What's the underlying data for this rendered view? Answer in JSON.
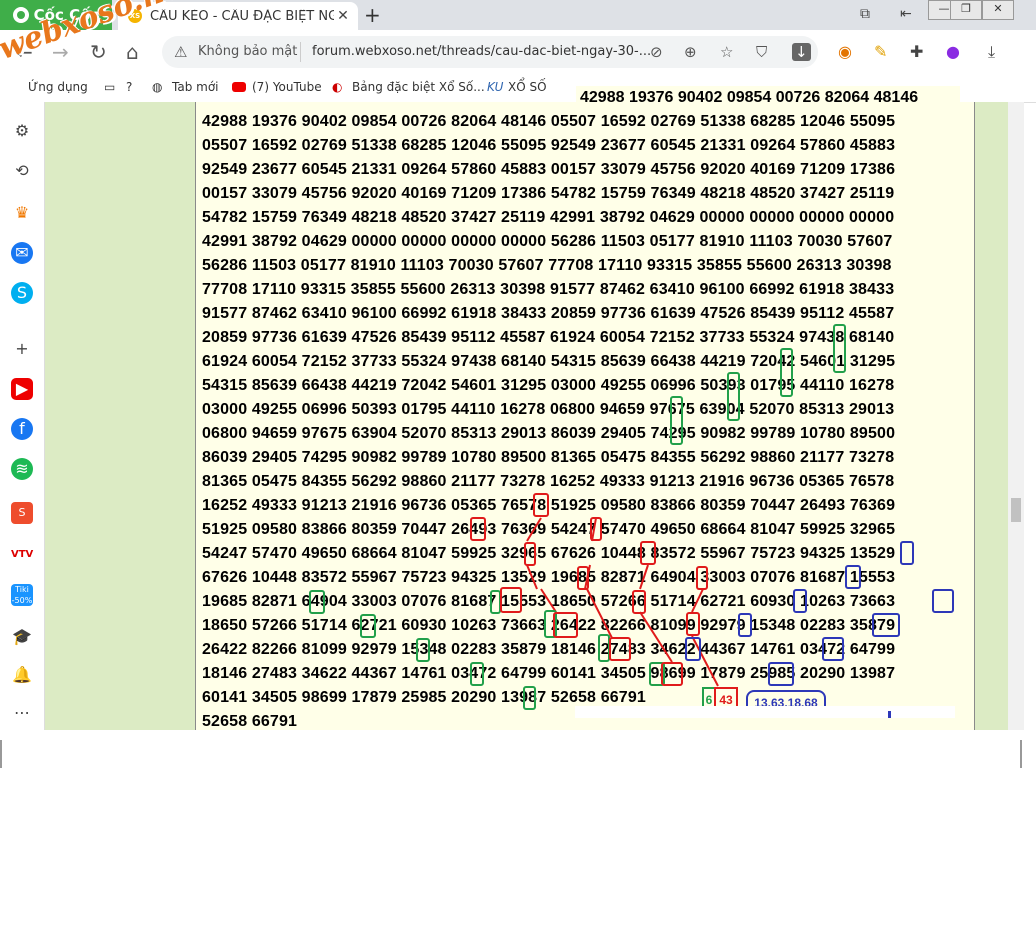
{
  "browser": {
    "brand": "Cốc Cốc",
    "tab_favicon": "XS",
    "tab_title": "CẦU KÈO - CẦU ĐẶC BIỆT NG",
    "security_label": "Không bảo mật",
    "url": "forum.webxoso.net/threads/cau-dac-biet-ngay-30-...",
    "bookmarks": [
      {
        "label": "Ứng dụng"
      },
      {
        "label": "?"
      },
      {
        "label": "Tab mới"
      },
      {
        "label": "(7) YouTube"
      },
      {
        "label": "Bảng đặc biệt Xổ Số..."
      },
      {
        "label": "XỔ SỐ"
      }
    ],
    "watermark": "webxoso.net"
  },
  "forum": {
    "top_line": "42988 19376 90402 09854 00726 82064 48146",
    "rows": [
      "42988 19376 90402 09854 00726 82064 48146 05507 16592 02769 51338 68285 12046 55095",
      "05507 16592 02769 51338 68285 12046 55095 92549 23677 60545 21331 09264 57860 45883",
      "92549 23677 60545 21331 09264 57860 45883 00157 33079 45756 92020 40169 71209 17386",
      "00157 33079 45756 92020 40169 71209 17386 54782 15759 76349 48218 48520 37427 25119",
      "54782 15759 76349 48218 48520 37427 25119 42991 38792 04629 00000 00000 00000 00000",
      "42991 38792 04629 00000 00000 00000 00000 56286 11503 05177 81910 11103 70030 57607",
      "56286 11503 05177 81910 11103 70030 57607 77708 17110 93315 35855 55600 26313 30398",
      "77708 17110 93315 35855 55600 26313 30398 91577 87462 63410 96100 66992 61918 38433",
      "91577 87462 63410 96100 66992 61918 38433 20859 97736 61639 47526 85439 95112 45587",
      "20859 97736 61639 47526 85439 95112 45587 61924 60054 72152 37733 55324 97438 68140",
      "61924 60054 72152 37733 55324 97438 68140 54315 85639 66438 44219 72042 54601 31295",
      "54315 85639 66438 44219 72042 54601 31295 03000 49255 06996 50393 01795 44110 16278",
      "03000 49255 06996 50393 01795 44110 16278 06800 94659 97675 63904 52070 85313 29013",
      "06800 94659 97675 63904 52070 85313 29013 86039 29405 74295 90982 99789 10780 89500",
      "86039 29405 74295 90982 99789 10780 89500 81365 05475 84355 56292 98860 21177 73278",
      "81365 05475 84355 56292 98860 21177 73278 16252 49333 91213 21916 96736 05365 76578",
      "16252 49333 91213 21916 96736 05365 76578 51925 09580 83866 80359 70447 26493 76369",
      "51925 09580 83866 80359 70447 26493 76369 54247 57470 49650 68664 81047 59925 32965",
      "54247 57470 49650 68664 81047 59925 32965 67626 10448 83572 55967 75723 94325 13529",
      "67626 10448 83572 55967 75723 94325 13529 19685 82871 64904 33003 07076 81687 15553",
      "19685 82871 64904 33003 07076 81687 15553 18650 57266 51714 62721 60930 10263 73663",
      "18650 57266 51714 62721 60930 10263 73663 26422 82266 81099 92979 15348 02283 35879",
      "26422 82266 81099 92979 15348 02283 35879 18146 27483 34622 44367 14761 03472 64799",
      "18146 27483 34622 44367 14761 03472 64799 60141 34505 98699 17879 25985 20290 13987",
      "60141 34505 98699 17879 25985 20290 13987 52658 66791",
      "52658 66791"
    ],
    "annotations": {
      "green_tag": "6",
      "red_tag": "43",
      "blue_tag": "13,63,18,68"
    }
  },
  "colors": {
    "annotation_green": "#22a04a",
    "annotation_red": "#e01b1b",
    "annotation_blue": "#2d38b8",
    "brand_green": "#3fae49",
    "page_bg": "#dcebc4",
    "post_bg": "#ffffe8"
  }
}
